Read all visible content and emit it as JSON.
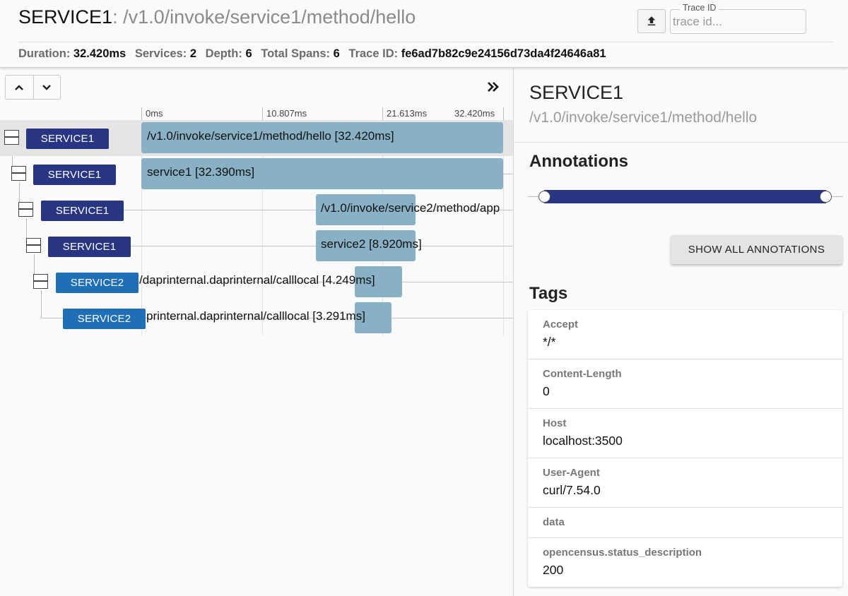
{
  "header": {
    "service": "SERVICE1",
    "separator": ":",
    "path": "/v1.0/invoke/service1/method/hello",
    "trace_id_legend": "Trace ID",
    "trace_id_placeholder": "trace id...",
    "upload_icon": "upload-icon"
  },
  "stats": {
    "duration_label": "Duration:",
    "duration": "32.420ms",
    "services_label": "Services:",
    "services": "2",
    "depth_label": "Depth:",
    "depth": "6",
    "spans_label": "Total Spans:",
    "spans": "6",
    "traceid_label": "Trace ID:",
    "traceid": "fe6ad7b82c9e24156d73da4f24646a81"
  },
  "timeline": {
    "ticks": [
      "0ms",
      "10.807ms",
      "21.613ms",
      "32.420ms"
    ],
    "spans": [
      {
        "service": "SERVICE1",
        "label": "/v1.0/invoke/service1/method/hello [32.420ms]"
      },
      {
        "service": "SERVICE1",
        "label": "service1 [32.390ms]"
      },
      {
        "service": "SERVICE1",
        "label": "/v1.0/invoke/service2/method/app"
      },
      {
        "service": "SERVICE1",
        "label": "service2 [8.920ms]"
      },
      {
        "service": "SERVICE2",
        "label": "/daprinternal.daprinternal/calllocal [4.249ms]"
      },
      {
        "service": "SERVICE2",
        "label": "printernal.daprinternal/calllocal [3.291ms]"
      }
    ]
  },
  "detail": {
    "service": "SERVICE1",
    "path": "/v1.0/invoke/service1/method/hello",
    "annotations_heading": "Annotations",
    "show_all_label": "SHOW ALL ANNOTATIONS",
    "tags_heading": "Tags",
    "tags": [
      {
        "key": "Accept",
        "value": "*/*"
      },
      {
        "key": "Content-Length",
        "value": "0"
      },
      {
        "key": "Host",
        "value": "localhost:3500"
      },
      {
        "key": "User-Agent",
        "value": "curl/7.54.0"
      },
      {
        "key": "data",
        "value": ""
      },
      {
        "key": "opencensus.status_description",
        "value": "200"
      }
    ]
  },
  "colors": {
    "service1": "#283582",
    "service2": "#1e6fb5",
    "span_bar": "#89b1c6"
  }
}
